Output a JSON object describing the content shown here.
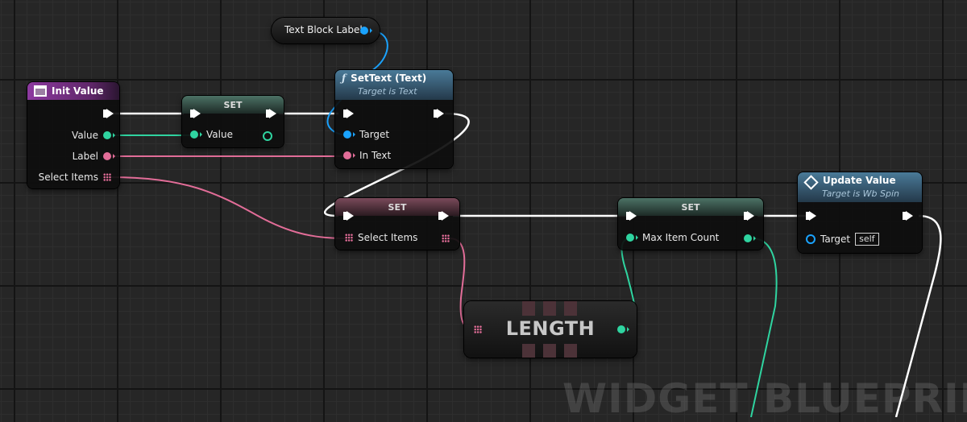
{
  "colors": {
    "exec": "#ffffff",
    "int": "#2fd4a0",
    "text": "#e26d98",
    "object": "#1aa3ff",
    "event_header": "#7a2a8a",
    "function_header": "#3c6a88",
    "set_header": "#3b5a4e"
  },
  "watermark": "WIDGET BLUEPRINT",
  "nodes": {
    "text_block_label": {
      "title": "Text Block Label"
    },
    "init_value": {
      "title": "Init Value",
      "icon": "function-icon",
      "pins": {
        "value": "Value",
        "label": "Label",
        "select_items": "Select Items"
      }
    },
    "set_value": {
      "title": "SET",
      "pins": {
        "value": "Value"
      }
    },
    "set_text": {
      "title": "SetText (Text)",
      "subtitle": "Target is Text",
      "icon": "function-f-icon",
      "pins": {
        "target": "Target",
        "in_text": "In Text"
      }
    },
    "set_select_items": {
      "title": "SET",
      "pins": {
        "select_items": "Select Items"
      }
    },
    "set_max_item_count": {
      "title": "SET",
      "pins": {
        "max_item_count": "Max Item Count"
      }
    },
    "update_value": {
      "title": "Update Value",
      "subtitle": "Target is Wb Spin",
      "icon": "event-diamond-icon",
      "pins": {
        "target": "Target",
        "self": "self"
      }
    },
    "length": {
      "title": "LENGTH"
    }
  }
}
